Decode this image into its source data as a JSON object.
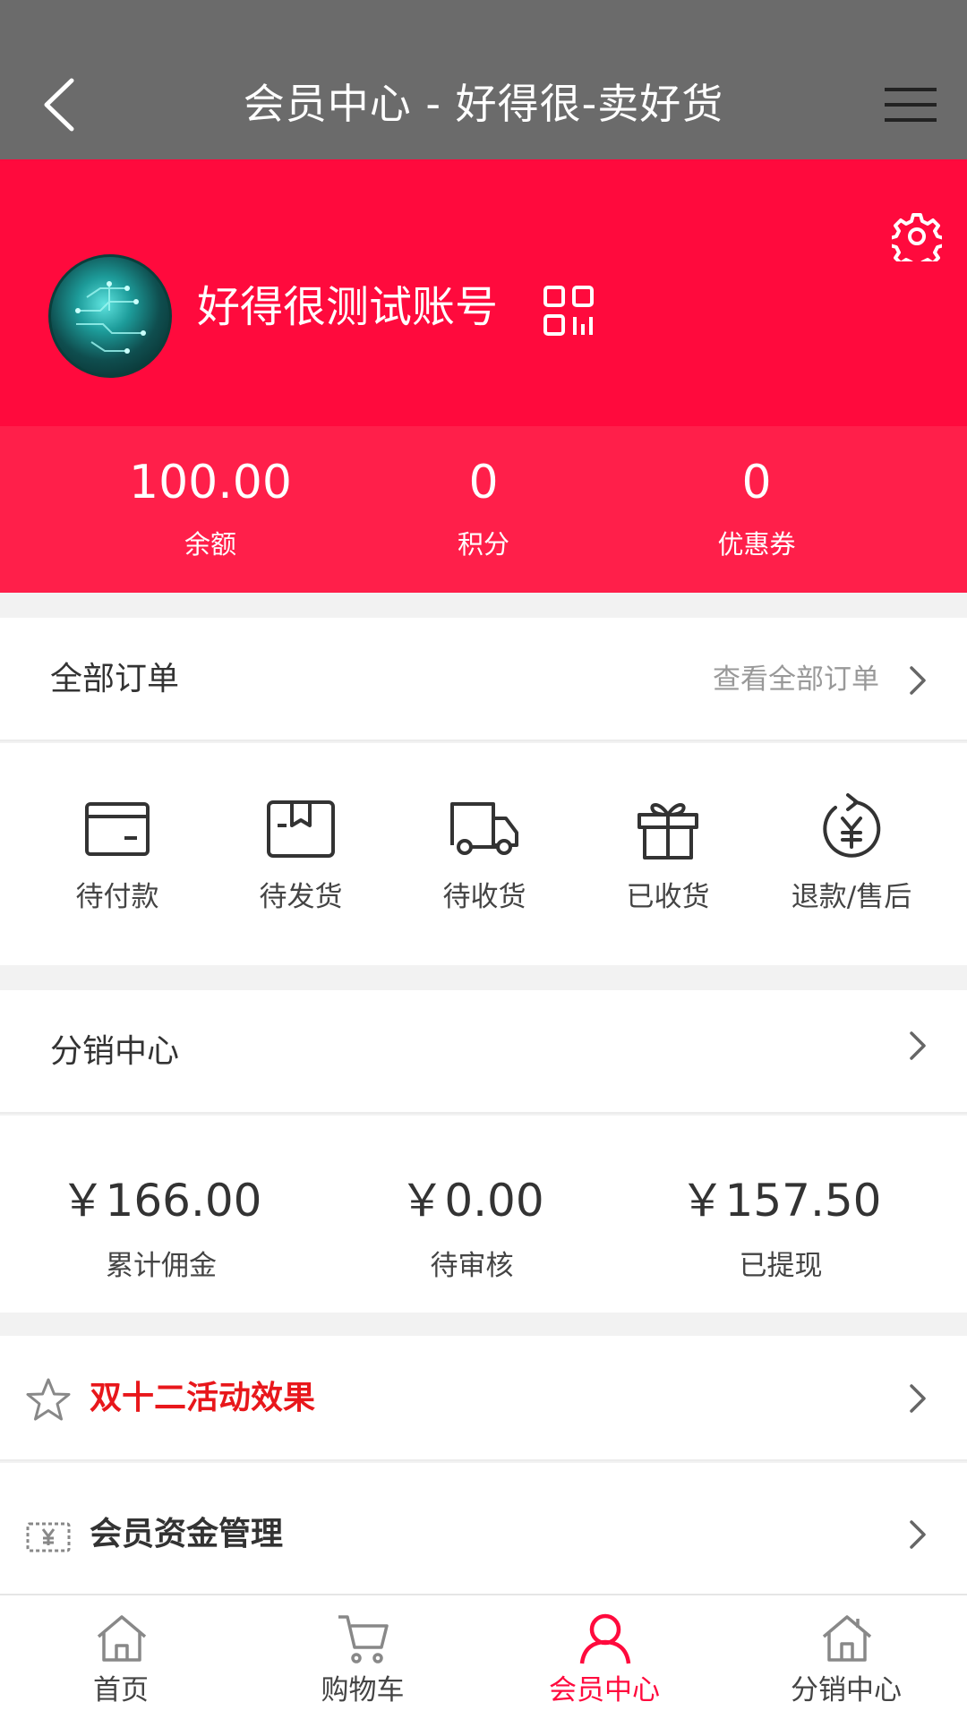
{
  "header": {
    "title": "会员中心 - 好得很-卖好货",
    "back_icon": "chevron-left-icon",
    "menu_icon": "hamburger-menu-icon"
  },
  "profile": {
    "username": "好得很测试账号",
    "settings_icon": "gear-icon",
    "qr_icon": "qr-code-icon"
  },
  "stats": [
    {
      "value": "100.00",
      "label": "余额"
    },
    {
      "value": "0",
      "label": "积分"
    },
    {
      "value": "0",
      "label": "优惠券"
    }
  ],
  "orders": {
    "title": "全部订单",
    "view_all": "查看全部订单",
    "items": [
      {
        "label": "待付款",
        "icon": "wallet-icon"
      },
      {
        "label": "待发货",
        "icon": "box-icon"
      },
      {
        "label": "待收货",
        "icon": "truck-icon"
      },
      {
        "label": "已收货",
        "icon": "gift-icon"
      },
      {
        "label": "退款/售后",
        "icon": "refund-icon"
      }
    ]
  },
  "distribution": {
    "title": "分销中心",
    "amounts": [
      {
        "value": "￥166.00",
        "label": "累计佣金"
      },
      {
        "value": "￥0.00",
        "label": "待审核"
      },
      {
        "value": "￥157.50",
        "label": "已提现"
      }
    ]
  },
  "links": [
    {
      "label": "双十二活动效果",
      "icon": "star-icon",
      "color": "#e8171b"
    },
    {
      "label": "会员资金管理",
      "icon": "money-bill-icon",
      "color": "#333333"
    }
  ],
  "tabbar": [
    {
      "label": "首页",
      "icon": "home-icon",
      "active": false
    },
    {
      "label": "购物车",
      "icon": "cart-icon",
      "active": false
    },
    {
      "label": "会员中心",
      "icon": "user-icon",
      "active": true
    },
    {
      "label": "分销中心",
      "icon": "distribution-home-icon",
      "active": false
    }
  ],
  "colors": {
    "brand_red": "#ff0a3d",
    "stats_red": "#ff1f4a",
    "header_gray": "#6b6b6b",
    "accent_text": "#e8171b"
  }
}
